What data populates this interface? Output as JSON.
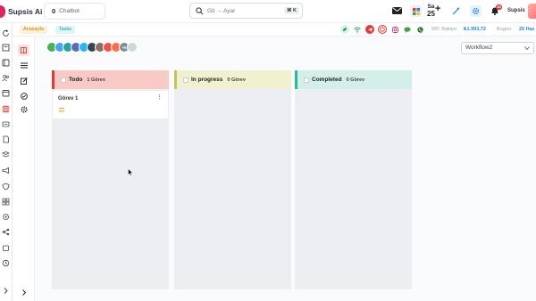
{
  "app": {
    "name": "Supsis Ai"
  },
  "header": {
    "chatbot_count": "0",
    "chatbot_label": "Chatbot",
    "search_placeholder": "Git → Ayar",
    "search_shortcut": "⌘ K",
    "sa_label": "Sa",
    "sa_number": "25",
    "notification_count": "38",
    "user_name": "Supsis"
  },
  "subbar": {
    "crumbs": [
      "Anasayfa",
      "Tasks"
    ],
    "balance_label": "WP. Bakiye:",
    "balance_value": "₺1.993,72",
    "today_label": "Bugün:",
    "today_value": "25 Haz"
  },
  "board": {
    "workflow_selected": "Workflow2",
    "avatar_more": "+5",
    "columns": [
      {
        "title": "Todo",
        "count": "1 Görev",
        "color": "#f8c9c5",
        "accent": "#e53935",
        "cards": [
          {
            "title": "Görev 1",
            "menu": "⋮"
          }
        ]
      },
      {
        "title": "In progress",
        "count": "0 Görev",
        "color": "#f1f0cf",
        "accent": "#c7c35a",
        "cards": []
      },
      {
        "title": "Completed",
        "count": "0 Görev",
        "color": "#d3efe9",
        "accent": "#1fbf9a",
        "cards": []
      }
    ]
  },
  "colors": {
    "priority": "#f5a623",
    "accent": "#1e88e5"
  }
}
